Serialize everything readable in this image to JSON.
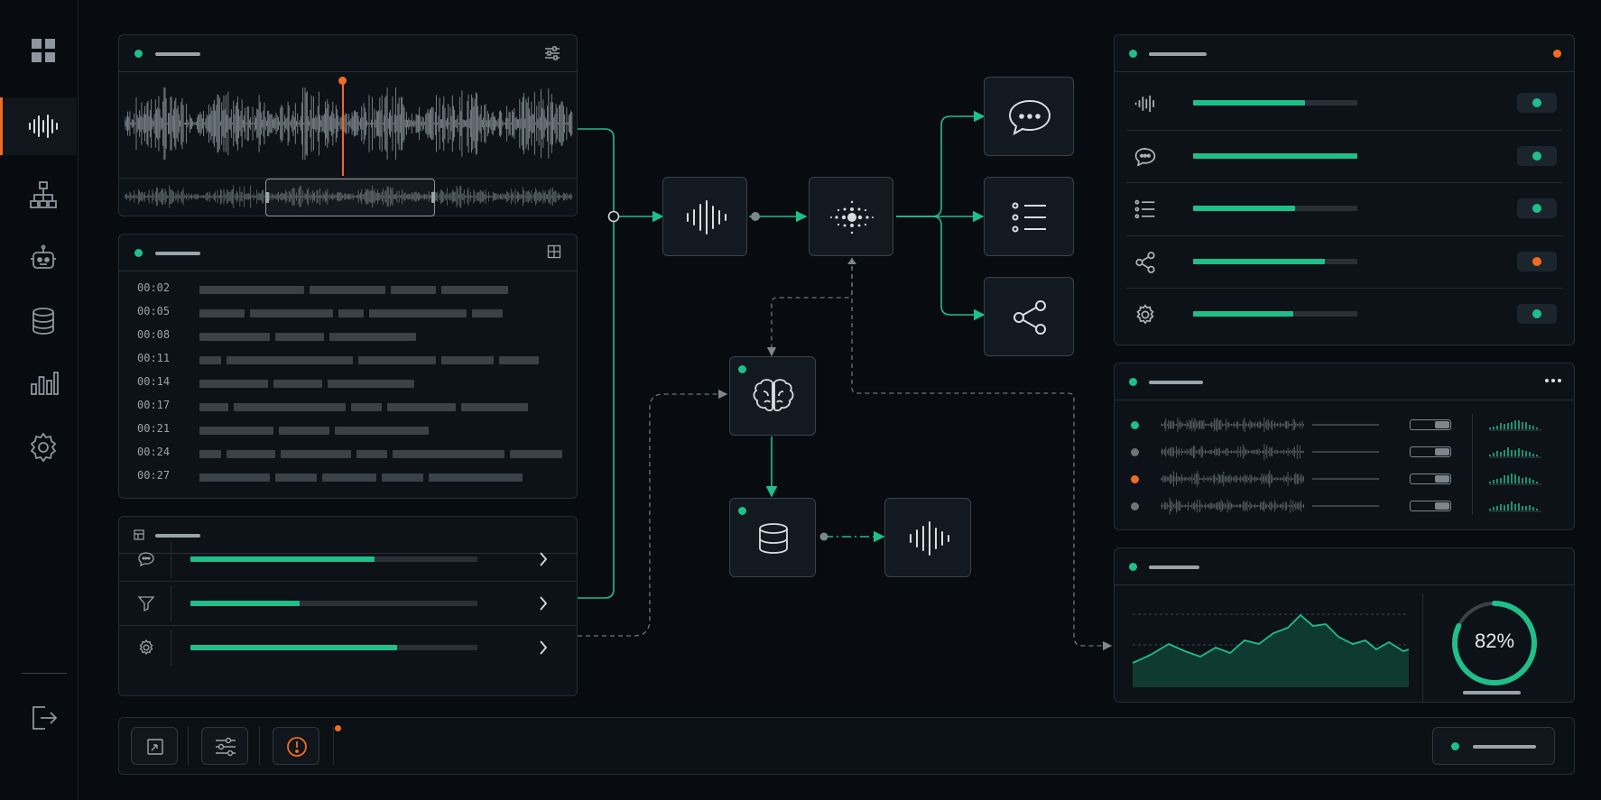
{
  "sidebar": {
    "items": [
      {
        "name": "grid-icon"
      },
      {
        "name": "waveform-icon",
        "active": true
      },
      {
        "name": "hierarchy-icon"
      },
      {
        "name": "robot-icon"
      },
      {
        "name": "database-icon"
      },
      {
        "name": "bar-chart-icon"
      },
      {
        "name": "gear-icon"
      }
    ],
    "logout_icon": "logout-icon"
  },
  "transcript": {
    "timestamps": [
      "00:02",
      "00:05",
      "00:08",
      "00:11",
      "00:14",
      "00:17",
      "00:21",
      "00:24",
      "00:27"
    ]
  },
  "controls": {
    "rows": [
      {
        "icon": "chat-icon",
        "progress": 0.64
      },
      {
        "icon": "filter-icon",
        "progress": 0.38
      },
      {
        "icon": "gear-icon",
        "progress": 0.72
      }
    ]
  },
  "outputs_panel": {
    "rows": [
      {
        "icon": "waveform-icon",
        "progress": 0.68,
        "status": "#1fbf8a"
      },
      {
        "icon": "chat-icon",
        "progress": 1.0,
        "status": "#1fbf8a"
      },
      {
        "icon": "list-icon",
        "progress": 0.62,
        "status": "#1fbf8a"
      },
      {
        "icon": "share-icon",
        "progress": 0.8,
        "status": "#f26b22"
      },
      {
        "icon": "gear-icon",
        "progress": 0.61,
        "status": "#1fbf8a"
      }
    ]
  },
  "channels_panel": {
    "channels": [
      {
        "status": "#1fbf8a"
      },
      {
        "status": "#6b747c"
      },
      {
        "status": "#f26b22"
      },
      {
        "status": "#6b747c"
      }
    ]
  },
  "analytics": {
    "gauge_value": "82%",
    "gauge_fraction": 0.82
  },
  "colors": {
    "accent": "#1fbf8a",
    "warning": "#f26b22",
    "background": "#080b10"
  }
}
